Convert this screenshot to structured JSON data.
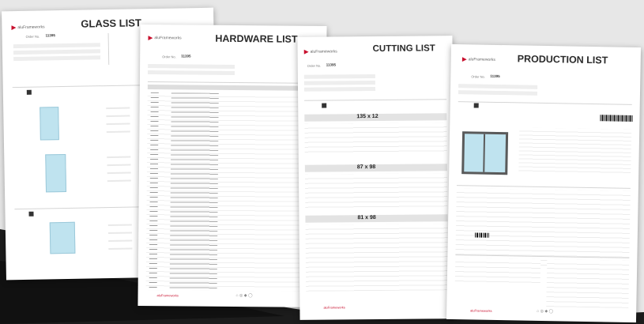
{
  "brand": {
    "name": "aluFrameworks",
    "accent_color": "#c8102e"
  },
  "documents": [
    {
      "id": "glass",
      "title": "GLASS LIST"
    },
    {
      "id": "hardware",
      "title": "HARDWARE LIST"
    },
    {
      "id": "cutting",
      "title": "CUTTING LIST"
    },
    {
      "id": "production",
      "title": "PRODUCTION LIST"
    }
  ],
  "order_number": "11395",
  "sections": {
    "cutting_headings": [
      "135 x 12",
      "87 x 98",
      "81 x 98"
    ]
  },
  "footer": {
    "icons": "⌂ ◎ ◆ ◯"
  }
}
